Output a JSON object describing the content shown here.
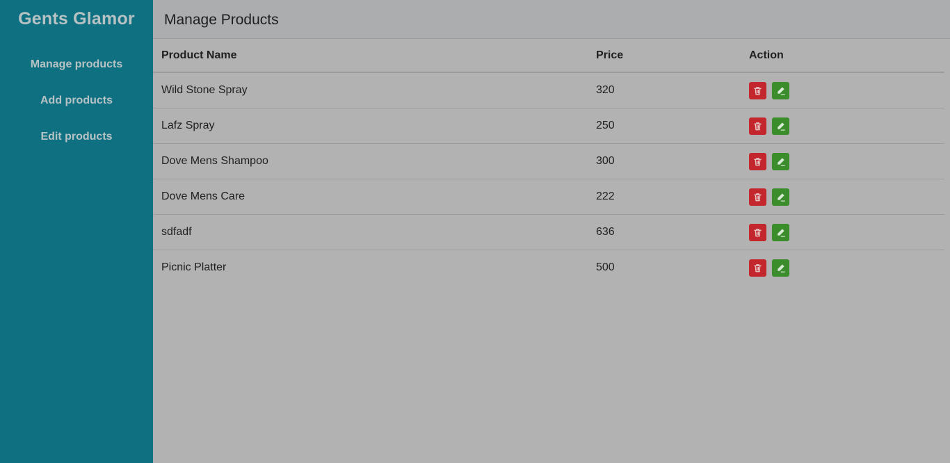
{
  "sidebar": {
    "brand": "Gents Glamor",
    "items": [
      {
        "label": "Manage products"
      },
      {
        "label": "Add products"
      },
      {
        "label": "Edit products"
      }
    ]
  },
  "header": {
    "title": "Manage Products"
  },
  "table": {
    "columns": [
      "Product Name",
      "Price",
      "Action"
    ],
    "rows": [
      {
        "name": "Wild Stone Spray",
        "price": "320"
      },
      {
        "name": "Lafz Spray",
        "price": "250"
      },
      {
        "name": "Dove Mens Shampoo",
        "price": "300"
      },
      {
        "name": "Dove Mens Care",
        "price": "222"
      },
      {
        "name": "sdfadf",
        "price": "636"
      },
      {
        "name": "Picnic Platter",
        "price": "500"
      }
    ]
  },
  "icons": {
    "delete": "trash-icon",
    "edit": "pencil-icon"
  },
  "colors": {
    "sidebar": "#0f7081",
    "delete": "#c3262c",
    "edit": "#3b8d2c"
  }
}
